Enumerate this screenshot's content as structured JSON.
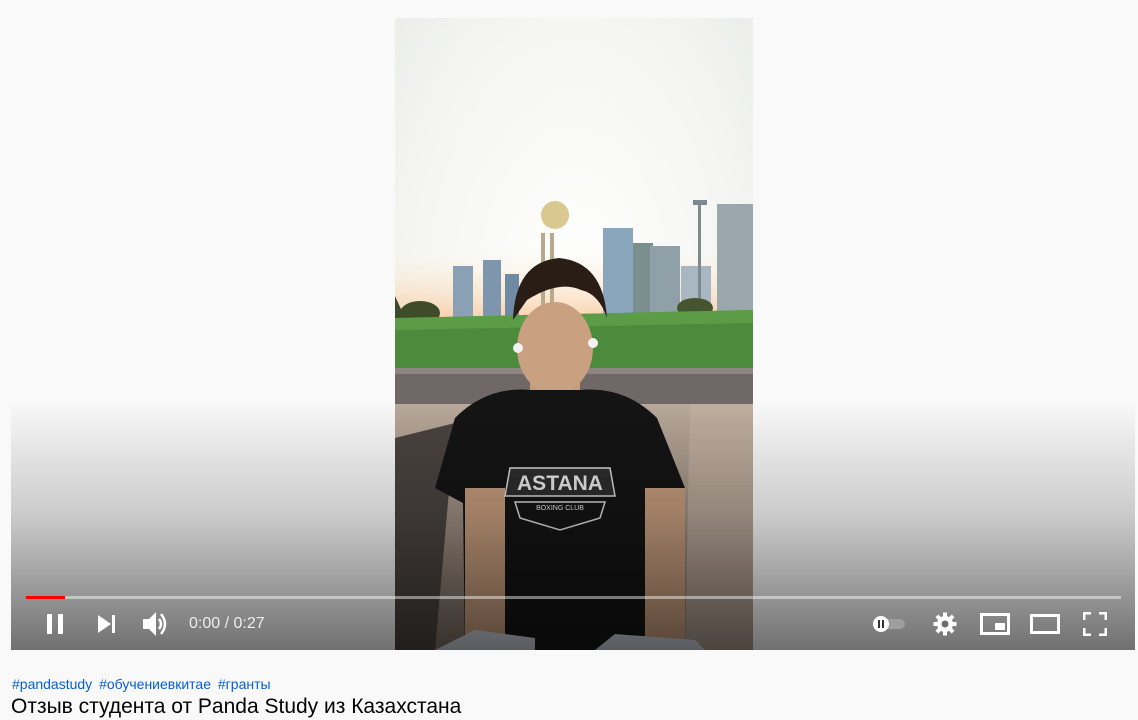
{
  "player": {
    "shirt_text": "ASTANA",
    "shirt_subtext": "BOXING CLUB",
    "progress_fraction": 0.036,
    "time_current": "0:00",
    "time_separator": " / ",
    "time_duration": "0:27",
    "accent_color": "#ff0000",
    "icons": [
      "pause-icon",
      "next-icon",
      "volume-icon",
      "autoplay-toggle-icon",
      "settings-gear-icon",
      "miniplayer-icon",
      "theater-mode-icon",
      "fullscreen-icon"
    ]
  },
  "video_info": {
    "hashtags": [
      "#pandastudy",
      "#обучениевкитае",
      "#гранты"
    ],
    "title": "Отзыв студента от Panda Study из Казахстана",
    "link_color": "#065fd4"
  }
}
